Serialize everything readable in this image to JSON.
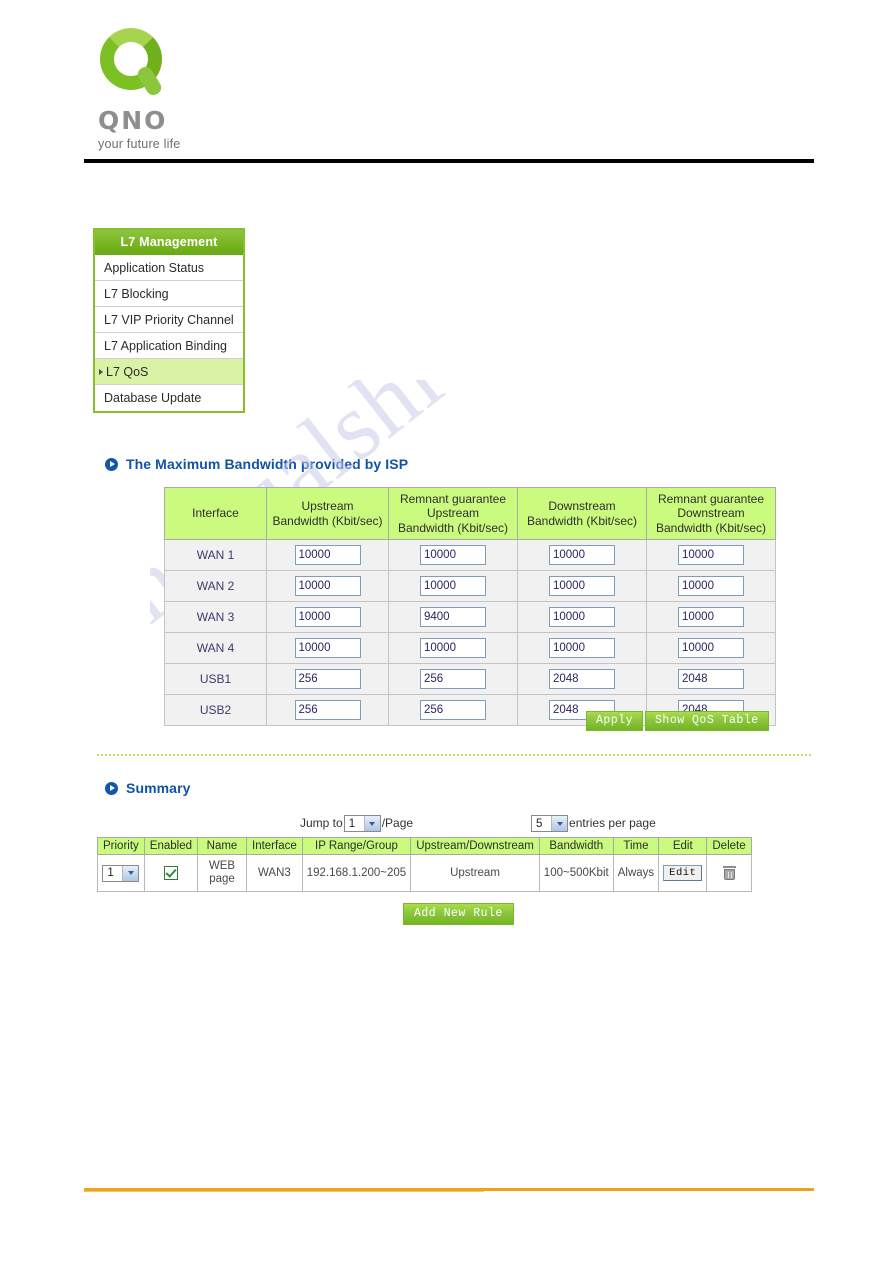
{
  "brand": {
    "logo_word": "QNO",
    "tagline": "your future life"
  },
  "watermark": {
    "text": "manualshive.com"
  },
  "sidebar": {
    "title": "L7 Management",
    "items": [
      {
        "label": "Application Status",
        "active": false
      },
      {
        "label": "L7 Blocking",
        "active": false
      },
      {
        "label": "L7 VIP Priority Channel",
        "active": false
      },
      {
        "label": "L7 Application Binding",
        "active": false
      },
      {
        "label": "L7 QoS",
        "active": true
      },
      {
        "label": "Database Update",
        "active": false
      }
    ]
  },
  "bandwidth_section": {
    "heading": "The Maximum Bandwidth provided by ISP",
    "columns": [
      "Interface",
      "Upstream Bandwidth (Kbit/sec)",
      "Remnant guarantee Upstream Bandwidth (Kbit/sec)",
      "Downstream Bandwidth (Kbit/sec)",
      "Remnant guarantee Downstream Bandwidth (Kbit/sec)"
    ],
    "column_lines": {
      "interface": [
        "Interface"
      ],
      "upstream": [
        "Upstream",
        "Bandwidth (Kbit/sec)"
      ],
      "remnant_upstream": [
        "Remnant guarantee",
        "Upstream",
        "Bandwidth (Kbit/sec)"
      ],
      "downstream": [
        "Downstream",
        "Bandwidth (Kbit/sec)"
      ],
      "remnant_downstream": [
        "Remnant guarantee",
        "Downstream",
        "Bandwidth (Kbit/sec)"
      ]
    },
    "rows": [
      {
        "interface": "WAN 1",
        "upstream": "10000",
        "remnant_upstream": "10000",
        "downstream": "10000",
        "remnant_downstream": "10000"
      },
      {
        "interface": "WAN 2",
        "upstream": "10000",
        "remnant_upstream": "10000",
        "downstream": "10000",
        "remnant_downstream": "10000"
      },
      {
        "interface": "WAN 3",
        "upstream": "10000",
        "remnant_upstream": "9400",
        "downstream": "10000",
        "remnant_downstream": "10000"
      },
      {
        "interface": "WAN 4",
        "upstream": "10000",
        "remnant_upstream": "10000",
        "downstream": "10000",
        "remnant_downstream": "10000"
      },
      {
        "interface": "USB1",
        "upstream": "256",
        "remnant_upstream": "256",
        "downstream": "2048",
        "remnant_downstream": "2048"
      },
      {
        "interface": "USB2",
        "upstream": "256",
        "remnant_upstream": "256",
        "downstream": "2048",
        "remnant_downstream": "2048"
      }
    ],
    "apply_label": "Apply",
    "show_table_label": "Show QoS Table"
  },
  "summary_section": {
    "heading": "Summary",
    "jump_label": "Jump to",
    "jump_value": "1",
    "page_suffix": "/Page",
    "entries_value": "5",
    "entries_suffix": "entries per page",
    "columns": [
      "Priority",
      "Enabled",
      "Name",
      "Interface",
      "IP Range/Group",
      "Upstream/Downstream",
      "Bandwidth",
      "Time",
      "Edit",
      "Delete"
    ],
    "rows": [
      {
        "priority": "1",
        "enabled": true,
        "name": "WEB page",
        "interface": "WAN3",
        "ip_range": "192.168.1.200~205",
        "direction": "Upstream",
        "bandwidth": "100~500Kbit",
        "time": "Always",
        "edit_label": "Edit",
        "delete_icon": "trash-icon"
      }
    ],
    "add_rule_label": "Add New Rule"
  },
  "colors": {
    "header_green": "#cbfb7e",
    "menu_green": "#8cc63f",
    "menu_active": "#daf2a6",
    "heading_blue": "#1053a8",
    "footer_orange": "#f0a31a",
    "watermark": "#c9cbe8"
  }
}
